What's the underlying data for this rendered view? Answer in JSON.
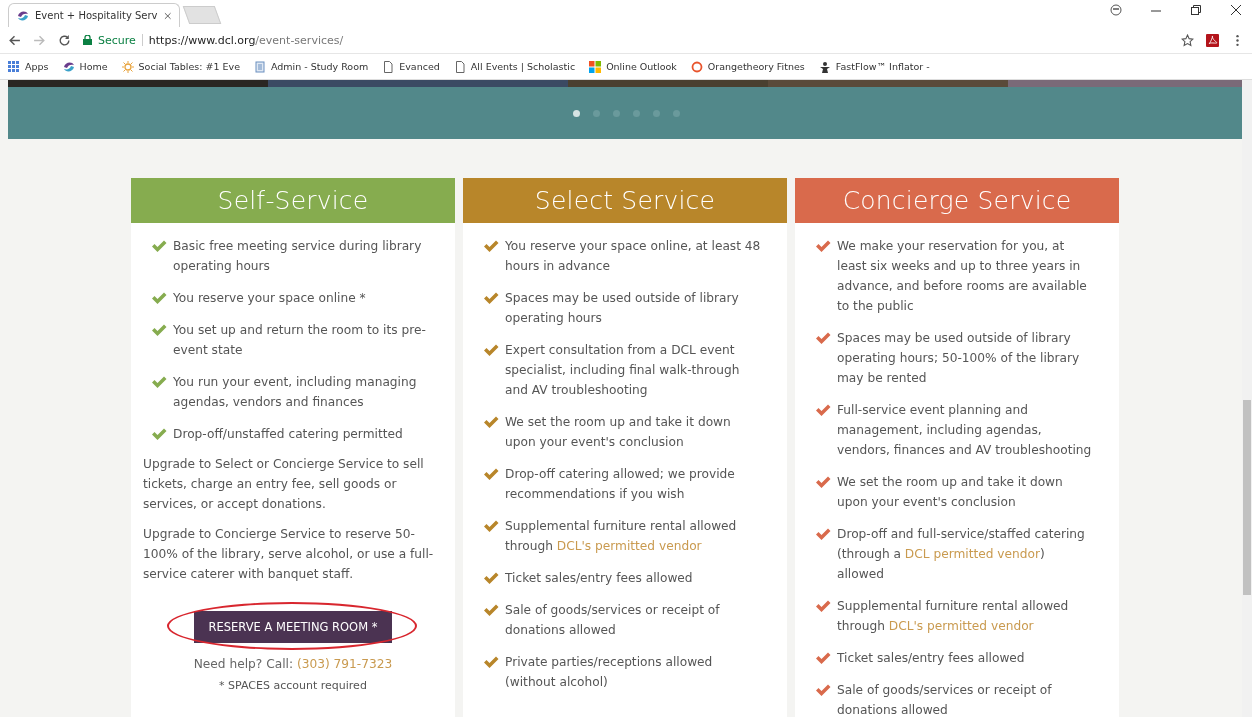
{
  "browser": {
    "tab": {
      "title": "Event + Hospitality Serv",
      "selected": true
    },
    "address": {
      "secure_label": "Secure",
      "url_host": "https://www.dcl.org",
      "url_path": "/event-services/"
    },
    "bookmarks": [
      {
        "label": "Apps",
        "kind": "apps"
      },
      {
        "label": "Home",
        "kind": "logo"
      },
      {
        "label": "Social Tables: #1 Eve",
        "kind": "sun"
      },
      {
        "label": "Admin - Study Room",
        "kind": "doc"
      },
      {
        "label": "Evanced",
        "kind": "page"
      },
      {
        "label": "All Events | Scholastic",
        "kind": "page"
      },
      {
        "label": "Online Outlook",
        "kind": "tiles"
      },
      {
        "label": "Orangetheory Fitnes",
        "kind": "ring"
      },
      {
        "label": "FastFlow™ Inflator -",
        "kind": "figure"
      }
    ]
  },
  "carousel": {
    "dots": [
      {
        "selected": true
      },
      {
        "selected": false
      },
      {
        "selected": false
      },
      {
        "selected": false
      },
      {
        "selected": false
      },
      {
        "selected": false
      }
    ]
  },
  "plans": [
    {
      "title": "Self-Service",
      "color": "#86ac4f",
      "items": [
        {
          "text": "Basic free meeting service during library operating hours"
        },
        {
          "text": "You reserve your space online *"
        },
        {
          "text": "You set up and return the room to its pre-event state"
        },
        {
          "text": "You run your event, including managing agendas, vendors and finances"
        },
        {
          "text": "Drop-off/unstaffed catering permitted"
        }
      ],
      "notes": [
        "Upgrade to Select or Concierge Service to sell tickets, charge an entry fee, sell goods or services, or accept donations.",
        "Upgrade to Concierge Service to reserve 50-100% of the library, serve alcohol, or use a full-service caterer with banquet staff."
      ],
      "button": {
        "label": "RESERVE A MEETING ROOM *",
        "circled": true
      },
      "help": {
        "text": "Need help? Call: ",
        "phone": "(303) 791-7323"
      },
      "footnote": "* SPACES account required"
    },
    {
      "title": "Select Service",
      "color": "#b8862a",
      "items": [
        {
          "text": "You reserve your space online, at least 48 hours in advance"
        },
        {
          "text": "Spaces may be used outside of library operating hours"
        },
        {
          "text": "Expert consultation from a DCL event specialist, including final walk-through and AV troubleshooting"
        },
        {
          "text": "We set the room up and take it down upon your event's conclusion"
        },
        {
          "text": "Drop-off catering allowed; we provide recommendations if you wish"
        },
        {
          "text": "Supplemental furniture rental allowed through ",
          "link": "DCL's permitted vendor"
        },
        {
          "text": "Ticket sales/entry fees allowed"
        },
        {
          "text": "Sale of goods/services or receipt of donations allowed"
        },
        {
          "text": "Private parties/receptions allowed (without alcohol)"
        }
      ]
    },
    {
      "title": "Concierge Service",
      "color": "#d96a4c",
      "items": [
        {
          "text": "We make your reservation for you, at least six weeks and up to three years in advance, and before rooms are available to the public"
        },
        {
          "text": "Spaces may be used outside of library operating hours; 50-100% of the library may be rented"
        },
        {
          "text": "Full-service event planning and management, including agendas, vendors, finances and AV troubleshooting"
        },
        {
          "text": "We set the room up and take it down upon your event's conclusion"
        },
        {
          "text": "Drop-off and full-service/staffed catering (through a ",
          "link": "DCL permitted vendor",
          "after": ") allowed"
        },
        {
          "text": "Supplemental furniture rental allowed through ",
          "link": "DCL's permitted vendor"
        },
        {
          "text": "Ticket sales/entry fees allowed"
        },
        {
          "text": "Sale of goods/services or receipt of donations allowed"
        }
      ]
    }
  ]
}
